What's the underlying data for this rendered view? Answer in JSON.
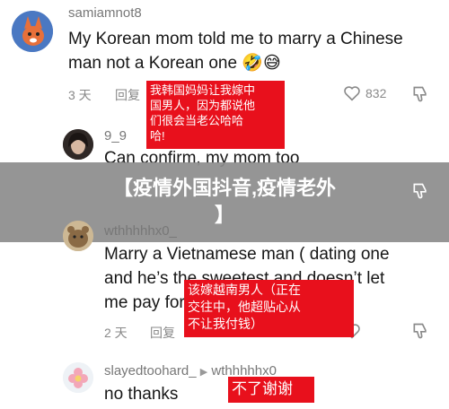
{
  "comments": [
    {
      "username": "samiamnot8",
      "text_line1": "My Korean mom told me to marry a Chinese",
      "text_line2": "man not a Korean one 🤣😅",
      "time": "3 天",
      "reply": "回复",
      "likes": "832",
      "note": [
        "我韩国妈妈让我嫁中",
        "国男人，因为都说他",
        "们很会当老公哈哈",
        "哈!"
      ]
    },
    {
      "username": "9_9",
      "text_line1": "Can confirm, my mom too"
    },
    {
      "username": "wthhhhhx0_",
      "text_line1": "Marry a Vietnamese man ( dating one",
      "text_line2": "and he’s the sweetest and doesn’t let",
      "text_line3": "me pay for",
      "time": "2 天",
      "reply": "回复",
      "likes": "...",
      "note": [
        "该嫁越南男人（正在",
        "交往中，他超贴心从",
        "不让我付钱）"
      ]
    },
    {
      "username": "slayedtoohard_",
      "reply_to": "wthhhhhx0_",
      "text_line1": "no thanks",
      "note": [
        "不了谢谢"
      ]
    }
  ],
  "banner": {
    "line1": "【疫情外国抖音,疫情老外",
    "line2": "】"
  }
}
